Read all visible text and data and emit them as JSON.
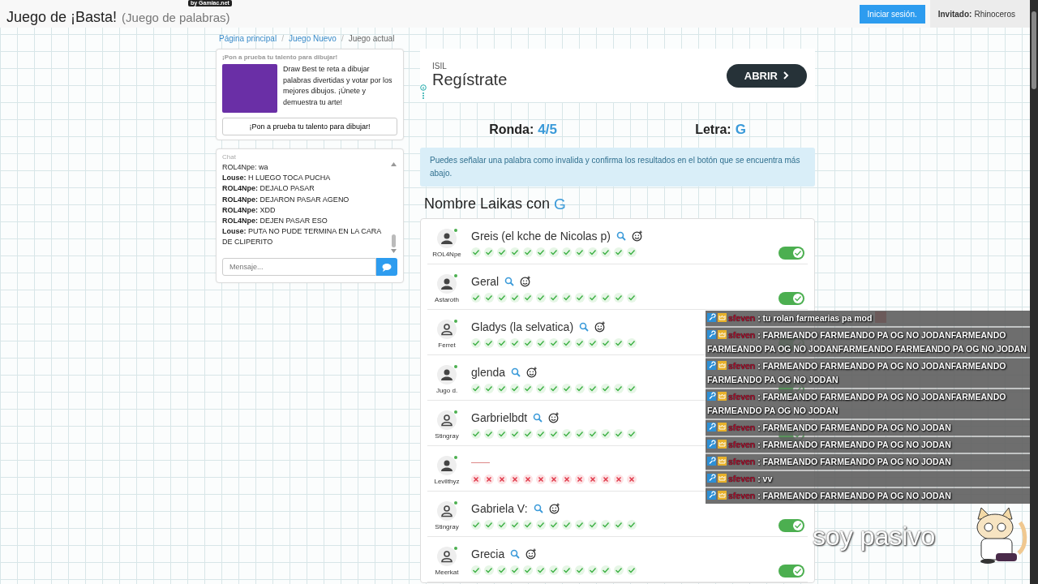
{
  "header": {
    "title": "Juego de ¡Basta!",
    "subtitle": "(Juego de palabras)",
    "badge": "by Gamiac.net",
    "login_button": "Iniciar sesión.",
    "guest_label": "Invitado:",
    "guest_name": "Rhinoceros"
  },
  "breadcrumb": [
    {
      "kind": "link",
      "label": "Página principal"
    },
    {
      "kind": "separator",
      "label": "/"
    },
    {
      "kind": "link",
      "label": "Juego Nuevo"
    },
    {
      "kind": "separator",
      "label": "/"
    },
    {
      "kind": "current",
      "label": "Juego actual"
    }
  ],
  "promo": {
    "heading": "¡Pon a prueba tu talento para dibujar!",
    "text": "Draw Best te reta a dibujar palabras divertidas y votar por los mejores dibujos. ¡Únete y demuestra tu arte!",
    "button": "¡Pon a prueba tu talento para dibujar!"
  },
  "chat": {
    "title": "Chat",
    "partial_line": "ROL4Npe: wa",
    "messages": [
      {
        "user": "Louse:",
        "text": "H LUEGO TOCA PUCHA"
      },
      {
        "user": "ROL4Npe:",
        "text": "DEJALO PASAR"
      },
      {
        "user": "ROL4Npe:",
        "text": "DEJARON PASAR AGENO"
      },
      {
        "user": "ROL4Npe:",
        "text": "XDD"
      },
      {
        "user": "ROL4Npe:",
        "text": "DEJEN PASAR ESO"
      },
      {
        "user": "Louse:",
        "text": "PUTA NO PUDE TERMINA EN LA CARA DE CLIPERITO"
      }
    ],
    "placeholder": "Mensaje..."
  },
  "ad": {
    "brand": "ISIL",
    "headline": "Regístrate",
    "button": "ABRIR"
  },
  "round": {
    "label": "Ronda:",
    "value": "4/5"
  },
  "letter": {
    "label": "Letra:",
    "value": "G"
  },
  "notice": "Puedes señalar una palabra como invalida y confirma los resultados en el botón que se encuentra más abajo.",
  "category": {
    "label": "Nombre Laikas con",
    "letter": "G"
  },
  "answers": [
    {
      "user": "ROL4Npe",
      "kind": "filled",
      "online": true,
      "word": "Greis (el kche de Nicolas p)",
      "valid": true,
      "on": true,
      "votes": [
        true,
        true,
        true,
        true,
        true,
        true,
        true,
        true,
        true,
        true,
        true,
        true,
        true
      ]
    },
    {
      "user": "Astaroth",
      "kind": "filled",
      "online": true,
      "word": "Geral",
      "valid": true,
      "on": true,
      "votes": [
        true,
        true,
        true,
        true,
        true,
        true,
        true,
        true,
        true,
        true,
        true,
        true,
        true
      ]
    },
    {
      "user": "Ferret",
      "kind": "outline",
      "online": true,
      "word": "Gladys (la selvatica)",
      "valid": true,
      "on": true,
      "votes": [
        true,
        true,
        true,
        true,
        true,
        true,
        true,
        true,
        true,
        true,
        true,
        true,
        true
      ]
    },
    {
      "user": "Jugo d.",
      "kind": "filled",
      "online": true,
      "word": "glenda",
      "valid": true,
      "on": true,
      "votes": [
        true,
        true,
        true,
        true,
        true,
        true,
        true,
        true,
        true,
        true,
        true,
        true,
        true
      ]
    },
    {
      "user": "Stingray",
      "kind": "outline",
      "online": true,
      "word": "Garbrielbdt",
      "valid": true,
      "on": true,
      "votes": [
        true,
        true,
        true,
        true,
        true,
        true,
        true,
        true,
        true,
        true,
        true,
        true,
        true
      ]
    },
    {
      "user": "Levilthyz",
      "kind": "filled",
      "online": true,
      "valid": false,
      "votes": [
        false,
        false,
        false,
        false,
        false,
        false,
        false,
        false,
        false,
        false,
        false,
        false,
        false
      ]
    },
    {
      "user": "Stingray",
      "kind": "outline",
      "online": true,
      "word": "Gabriela V:",
      "valid": true,
      "on": true,
      "votes": [
        true,
        true,
        true,
        true,
        true,
        true,
        true,
        true,
        true,
        true,
        true,
        true,
        true
      ]
    },
    {
      "user": "Meerkat",
      "kind": "outline",
      "online": true,
      "word": "Grecia",
      "valid": true,
      "on": true,
      "votes": [
        true,
        true,
        true,
        true,
        true,
        true,
        true,
        true,
        true,
        true,
        true,
        true,
        true
      ]
    }
  ],
  "stream_chat": [
    {
      "user": "sfeven",
      "text": ": tu rolan farmearias pa mod",
      "emote": true
    },
    {
      "user": "sfeven",
      "text": ": FARMEANDO FARMEANDO PA OG NO JODANFARMEANDO FARMEANDO PA OG NO JODANFARMEANDO FARMEANDO PA OG NO JODAN",
      "emote": false
    },
    {
      "user": "sfeven",
      "text": ": FARMEANDO FARMEANDO PA OG NO JODANFARMEANDO FARMEANDO PA OG NO JODAN",
      "emote": false
    },
    {
      "user": "sfeven",
      "text": ": FARMEANDO FARMEANDO PA OG NO JODANFARMEANDO FARMEANDO PA OG NO JODAN",
      "emote": false
    },
    {
      "user": "sfeven",
      "text": ": FARMEANDO FARMEANDO PA OG NO JODAN",
      "emote": false
    },
    {
      "user": "sfeven",
      "text": ": FARMEANDO FARMEANDO PA OG NO JODAN",
      "emote": false
    },
    {
      "user": "sfeven",
      "text": ": FARMEANDO FARMEANDO PA OG NO JODAN",
      "emote": false
    },
    {
      "user": "sfeven",
      "text": ": vv",
      "emote": false
    },
    {
      "user": "sfeven",
      "text": ": FARMEANDO FARMEANDO PA OG NO JODAN",
      "emote": false
    }
  ],
  "stream_caption": "soy pasivo"
}
